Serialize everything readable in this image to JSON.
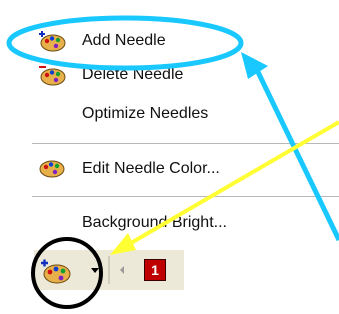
{
  "menu": {
    "items": [
      {
        "label": "Add Needle",
        "icon": "add-needle-icon"
      },
      {
        "label": "Delete Needle",
        "icon": "delete-needle-icon"
      },
      {
        "label": "Optimize Needles",
        "icon": ""
      },
      {
        "label": "Edit Needle Color...",
        "icon": "needle-color-icon"
      },
      {
        "label": "Background Bright...",
        "icon": ""
      }
    ]
  },
  "toolbar": {
    "needle_button_icon": "palette-icon",
    "dropdown_icon": "chevron-down-icon",
    "scroll_left_icon": "chevron-left-icon",
    "page_number": "1"
  },
  "colors": {
    "highlight_ellipse": "#19c8ff",
    "pointer_arrow_cyan": "#19c8ff",
    "pointer_arrow_yellow": "#ffff33",
    "circle_outline": "#000000",
    "page_badge": "#c00000"
  }
}
